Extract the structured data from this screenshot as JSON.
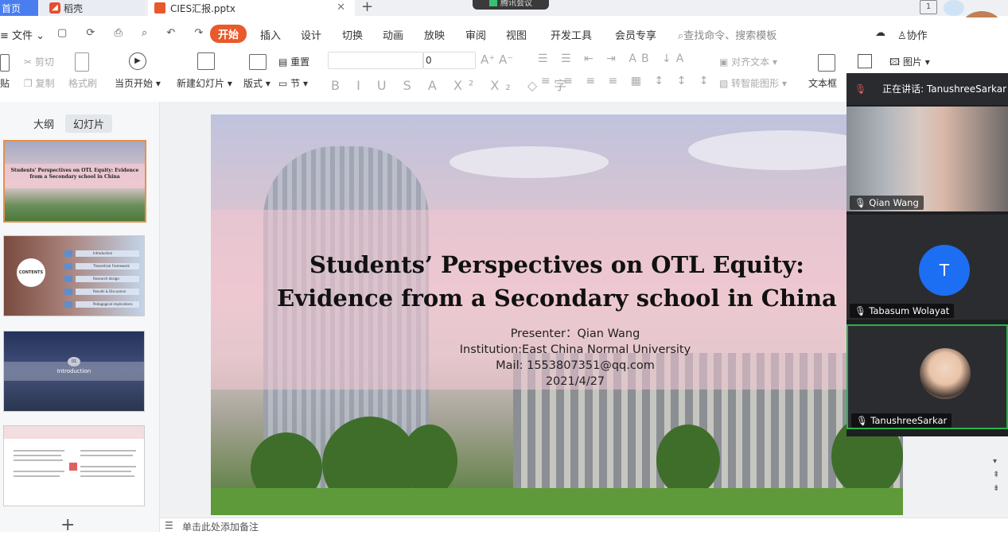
{
  "tabs": {
    "home": "首页",
    "daoke": "稻壳",
    "file": "CIES汇报.pptx",
    "meeting_bubble": "腾讯会议"
  },
  "menu": {
    "file": "文件",
    "items": [
      "开始",
      "插入",
      "设计",
      "切换",
      "动画",
      "放映",
      "审阅",
      "视图",
      "开发工具",
      "会员专享"
    ],
    "search": "查找命令、搜索模板",
    "collab": "协作"
  },
  "ribbon": {
    "paste": "贴",
    "cut": "剪切",
    "copy": "复制",
    "format_painter": "格式刷",
    "from_current": "当页开始",
    "new_slide": "新建幻灯片",
    "layout": "版式",
    "section": "节",
    "reset": "重置",
    "font_size": "0",
    "align_text": "对齐文本",
    "smart_shape": "转智能图形",
    "textbox": "文本框",
    "picture": "图片"
  },
  "leftpane": {
    "outline": "大纲",
    "slides": "幻灯片",
    "thumb1_title": "Students' Perspectives on OTL Equity: Evidence from a Secondary school in China",
    "thumb2_contents": "CONTENTS",
    "thumb2_items": [
      "Introduction",
      "Theoretical Framework",
      "Research design",
      "Results & Discussion",
      "Pedagogical implications"
    ],
    "thumb3_num": "01",
    "thumb3_title": "Introduction",
    "add": "+"
  },
  "slide": {
    "title_line1": "Students’ Perspectives on OTL Equity:",
    "title_line2": "Evidence from a Secondary school in China",
    "presenter": "Presenter：Qian Wang",
    "institution": "Institution:East China Normal University",
    "mail": "Mail: 1553807351@qq.com",
    "date": "2021/4/27"
  },
  "notes": "单击此处添加备注",
  "meeting": {
    "speaking": "正在讲话: TanushreeSarkar",
    "participants": [
      "Qian  Wang",
      "Tabasum Wolayat",
      "TanushreeSarkar"
    ],
    "avatar_letter": "T"
  },
  "colors": {
    "accent": "#e8592c",
    "home_tab": "#4a7ef0",
    "active_speaker": "#2bb24c",
    "avatar_blue": "#1c6ef2"
  }
}
